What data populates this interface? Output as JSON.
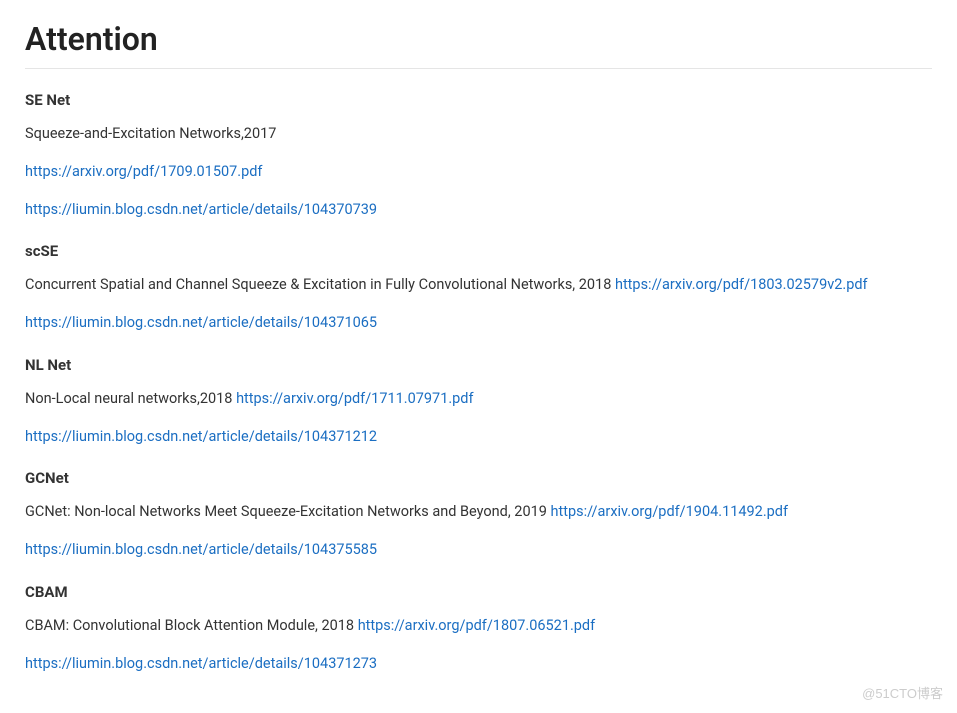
{
  "title": "Attention",
  "sections": [
    {
      "heading": "SE Net",
      "description": "Squeeze-and-Excitation Networks,2017",
      "inline_link": null,
      "links": [
        "https://arxiv.org/pdf/1709.01507.pdf",
        "https://liumin.blog.csdn.net/article/details/104370739"
      ]
    },
    {
      "heading": "scSE",
      "description": "Concurrent Spatial and Channel Squeeze & Excitation in Fully Convolutional Networks, 2018",
      "inline_link": "https://arxiv.org/pdf/1803.02579v2.pdf",
      "links": [
        "https://liumin.blog.csdn.net/article/details/104371065"
      ]
    },
    {
      "heading": "NL Net",
      "description": "Non-Local neural networks,2018",
      "inline_link": "https://arxiv.org/pdf/1711.07971.pdf",
      "links": [
        "https://liumin.blog.csdn.net/article/details/104371212"
      ]
    },
    {
      "heading": "GCNet",
      "description": "GCNet: Non-local Networks Meet Squeeze-Excitation Networks and Beyond, 2019",
      "inline_link": "https://arxiv.org/pdf/1904.11492.pdf",
      "links": [
        "https://liumin.blog.csdn.net/article/details/104375585"
      ]
    },
    {
      "heading": "CBAM",
      "description": "CBAM: Convolutional Block Attention Module, 2018",
      "inline_link": "https://arxiv.org/pdf/1807.06521.pdf",
      "links": [
        "https://liumin.blog.csdn.net/article/details/104371273"
      ]
    }
  ],
  "watermark": "@51CTO博客"
}
